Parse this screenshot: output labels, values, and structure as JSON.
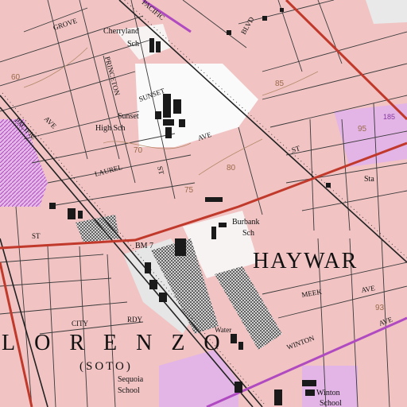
{
  "map": {
    "place_names": {
      "hayward": "HAYWAR",
      "lorenzo": "LORENZO",
      "soto": "(SOTO)"
    },
    "schools": {
      "cherryland": [
        "Cherryland",
        "Sch"
      ],
      "sunset": [
        "Sunset",
        "High Sch"
      ],
      "burbank": [
        "Burbank",
        "Sch"
      ],
      "sequoia": [
        "Sequoia",
        "School"
      ],
      "winton": [
        "Winton",
        "School"
      ]
    },
    "streets": {
      "grove": "GROVE",
      "princeton": "PRINCETON",
      "sunset_blvd": "SUNSET",
      "pacific": "PACIFIC",
      "ave_pacific": "AVE",
      "ave_sunset": "AVE",
      "laurel": "LAUREL",
      "st_laurel": "ST",
      "st_a": "ST",
      "st_west": "ST",
      "blvd": "BLVD",
      "pacific_top": "PACIFIC",
      "meek": "MEEK",
      "ave_meek": "AVE",
      "city": "CITY",
      "rdy": "RDY",
      "winton": "WINTON",
      "ave_winton": "AVE"
    },
    "features": {
      "sta": "Sta",
      "bm": "BM 7",
      "water": "Water"
    },
    "contours": [
      "60",
      "70",
      "75",
      "80",
      "85",
      "95",
      "93",
      "185"
    ],
    "colors": {
      "urban_tint": "#f1c3c3",
      "grid_lines": "#3a3a3a",
      "major_road": "#c0392b",
      "railroad": "#222222",
      "purple_revision": "#b04ac0",
      "building": "#1a1a1a",
      "white_area": "#fafafa"
    }
  }
}
